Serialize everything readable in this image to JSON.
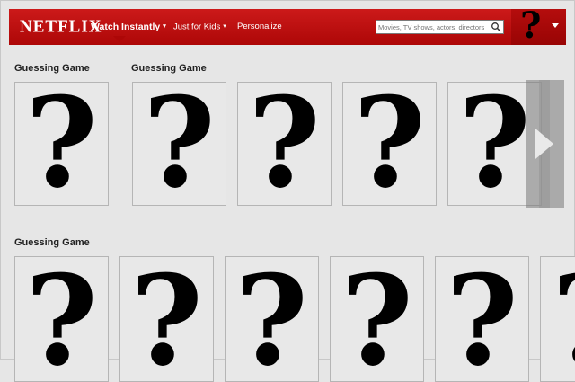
{
  "header": {
    "logo": "NETFLIX",
    "nav": [
      {
        "label": "Watch Instantly",
        "caret": "▾"
      },
      {
        "label": "Just for Kids",
        "caret": "▾"
      },
      {
        "label": "Personalize"
      }
    ],
    "search": {
      "placeholder": "Movies, TV shows, actors, directors"
    },
    "profile": {
      "avatar_glyph": "?"
    }
  },
  "rows": [
    {
      "title": "Guessing Game",
      "title2": "Guessing Game",
      "tiles": [
        "?",
        "?",
        "?",
        "?",
        "?"
      ]
    },
    {
      "title": "Guessing Game",
      "tiles": [
        "?",
        "?",
        "?",
        "?",
        "?",
        "?"
      ]
    }
  ],
  "colors": {
    "brand_red": "#b9090b",
    "background": "#e6e6e6"
  },
  "icons": {
    "search": "search-icon",
    "next": "chevron-right-icon"
  }
}
